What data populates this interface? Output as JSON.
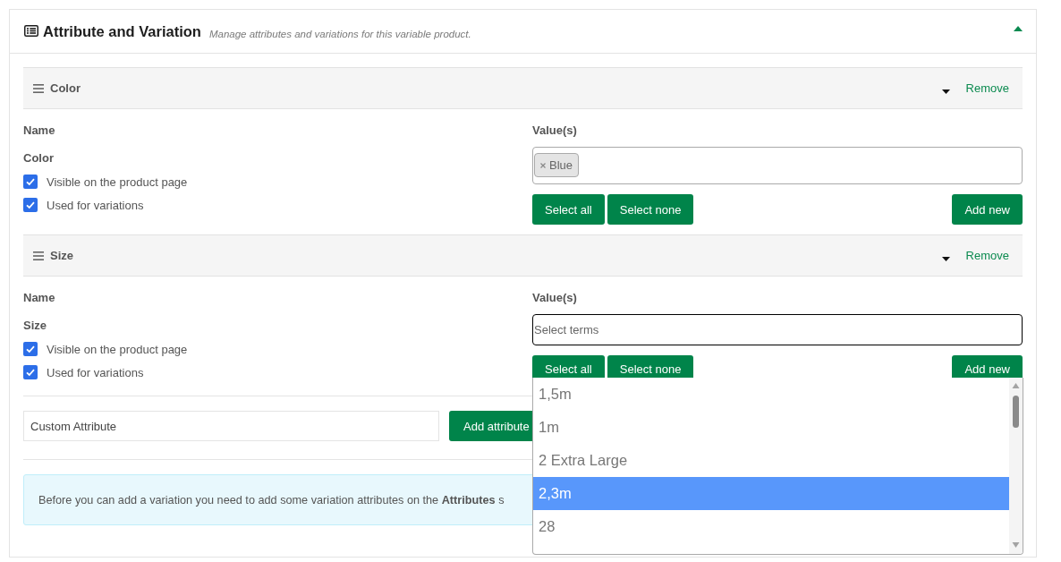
{
  "panel": {
    "title": "Attribute and Variation",
    "subtitle": "Manage attributes and variations for this variable product.",
    "expanded": true
  },
  "attributes": [
    {
      "title": "Color",
      "remove_label": "Remove",
      "name_label": "Name",
      "name_value": "Color",
      "options": [
        {
          "label": "Visible on the product page",
          "checked": true
        },
        {
          "label": "Used for variations",
          "checked": true
        }
      ],
      "values_label": "Value(s)",
      "values": [
        "Blue"
      ],
      "focused": false,
      "buttons": [
        "Select all",
        "Select none",
        "Add new"
      ]
    },
    {
      "title": "Size",
      "remove_label": "Remove",
      "name_label": "Name",
      "name_value": "Size",
      "options": [
        {
          "label": "Visible on the product page",
          "checked": true
        },
        {
          "label": "Used for variations",
          "checked": true
        }
      ],
      "values_label": "Value(s)",
      "placeholder": "Select terms",
      "focused": true,
      "buttons": [
        "Select all",
        "Select none",
        "Add new"
      ],
      "dropdown": {
        "options": [
          {
            "label": "1,5m",
            "selected": false
          },
          {
            "label": "1m",
            "selected": false
          },
          {
            "label": "2 Extra Large",
            "selected": false
          },
          {
            "label": "2,3m",
            "selected": true
          },
          {
            "label": "28",
            "selected": false
          }
        ]
      }
    }
  ],
  "custom_attribute": {
    "value": "Custom Attribute",
    "button": "Add attribute"
  },
  "notice": "Before you can add a variation you need to add some variation attributes on the **Attributes** s"
}
